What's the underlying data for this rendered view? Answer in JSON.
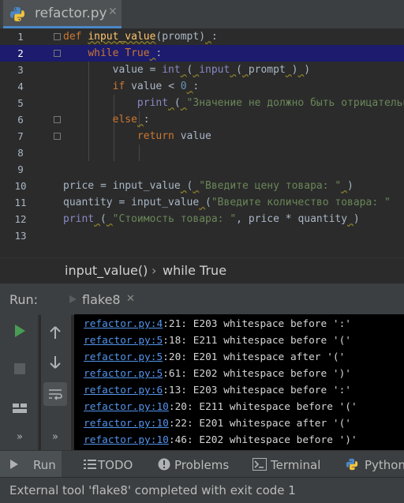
{
  "editor_tab": {
    "label": "refactor.py",
    "close": "✕"
  },
  "code_lines": [
    {
      "num": "1",
      "segs": [
        [
          "kw",
          "def "
        ],
        [
          "fn ul",
          "input_value"
        ],
        [
          "",
          "(prompt)"
        ],
        [
          "ul",
          " "
        ],
        [
          "",
          ":"
        ]
      ]
    },
    {
      "num": "2",
      "segs": [
        [
          "",
          "    "
        ],
        [
          "kw",
          "while "
        ],
        [
          "kw",
          "True"
        ],
        [
          "ul",
          " "
        ],
        [
          "",
          ":"
        ]
      ]
    },
    {
      "num": "3",
      "segs": [
        [
          "",
          "        value = "
        ],
        [
          "bi",
          "int"
        ],
        [
          "ul",
          " "
        ],
        [
          "",
          "("
        ],
        [
          "ul",
          " "
        ],
        [
          "bi",
          "input"
        ],
        [
          "ul",
          " "
        ],
        [
          "",
          "("
        ],
        [
          "ul",
          " "
        ],
        [
          "",
          "prompt"
        ],
        [
          "ul",
          " "
        ],
        [
          "",
          ")"
        ],
        [
          "ul",
          " "
        ],
        [
          "",
          ")"
        ]
      ]
    },
    {
      "num": "4",
      "segs": [
        [
          "",
          "        "
        ],
        [
          "kw",
          "if "
        ],
        [
          "",
          "value < "
        ],
        [
          "num",
          "0"
        ],
        [
          "ul",
          " "
        ],
        [
          "",
          ":"
        ]
      ]
    },
    {
      "num": "5",
      "segs": [
        [
          "",
          "            "
        ],
        [
          "bi",
          "print"
        ],
        [
          "ul",
          " "
        ],
        [
          "",
          "("
        ],
        [
          "ul",
          " "
        ],
        [
          "str",
          "\"Значение не должно быть отрицательным\""
        ]
      ]
    },
    {
      "num": "6",
      "segs": [
        [
          "",
          "        "
        ],
        [
          "kw",
          "else"
        ],
        [
          "ul",
          " "
        ],
        [
          "",
          ":"
        ]
      ]
    },
    {
      "num": "7",
      "segs": [
        [
          "",
          "            "
        ],
        [
          "kw",
          "return "
        ],
        [
          "",
          "value"
        ]
      ]
    },
    {
      "num": "8",
      "segs": []
    },
    {
      "num": "9",
      "segs": []
    },
    {
      "num": "10",
      "segs": [
        [
          "",
          "price = input_value"
        ],
        [
          "ul",
          " "
        ],
        [
          "",
          "("
        ],
        [
          "ul",
          " "
        ],
        [
          "str",
          "\"Введите цену товара: \""
        ],
        [
          "ul",
          " "
        ],
        [
          "",
          ")"
        ]
      ]
    },
    {
      "num": "11",
      "segs": [
        [
          "",
          "quantity = input_value"
        ],
        [
          "ul",
          " "
        ],
        [
          "",
          "("
        ],
        [
          "str",
          "\"Введите количество товара: \""
        ]
      ]
    },
    {
      "num": "12",
      "segs": [
        [
          "bi",
          "print"
        ],
        [
          "ul",
          " "
        ],
        [
          "",
          "("
        ],
        [
          "ul",
          " "
        ],
        [
          "str",
          "\"Стоимость товара: \""
        ],
        [
          "",
          ", price * quantity"
        ],
        [
          "ul",
          " "
        ],
        [
          "",
          ")"
        ]
      ]
    },
    {
      "num": "13",
      "segs": []
    }
  ],
  "breadcrumb": {
    "function": "input_value()",
    "separator": "›",
    "block": "while True"
  },
  "run_panel": {
    "title": "Run:",
    "tab_label": "flake8",
    "tab_close": "✕"
  },
  "console_lines": [
    {
      "link": "refactor.py:4",
      "text": ":21: E203 whitespace before ':'"
    },
    {
      "link": "refactor.py:5",
      "text": ":18: E211 whitespace before '('"
    },
    {
      "link": "refactor.py:5",
      "text": ":20: E201 whitespace after '('"
    },
    {
      "link": "refactor.py:5",
      "text": ":61: E202 whitespace before ')'"
    },
    {
      "link": "refactor.py:6",
      "text": ":13: E203 whitespace before ':'"
    },
    {
      "link": "refactor.py:10",
      "text": ":20: E211 whitespace before '('"
    },
    {
      "link": "refactor.py:10",
      "text": ":22: E201 whitespace after '('"
    },
    {
      "link": "refactor.py:10",
      "text": ":46: E202 whitespace before ')'"
    }
  ],
  "run_tools": {
    "more": "»"
  },
  "bottom_tabs": {
    "run": "Run",
    "todo": "TODO",
    "problems": "Problems",
    "terminal": "Terminal",
    "python": "Python"
  },
  "status_text": "External tool 'flake8' completed with exit code 1",
  "colors": {
    "accent": "#4a88c7",
    "run_green": "#499c54",
    "current_line": "#1c1b6e",
    "link": "#5394ec"
  }
}
